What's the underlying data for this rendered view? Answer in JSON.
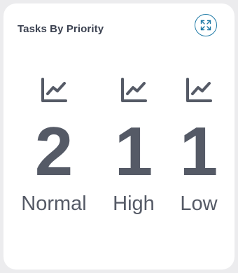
{
  "card": {
    "title": "Tasks By Priority",
    "expand_icon": "expand-arrows-icon"
  },
  "stats": [
    {
      "icon": "line-chart-icon",
      "value": "2",
      "label": "Normal"
    },
    {
      "icon": "line-chart-icon",
      "value": "1",
      "label": "High"
    },
    {
      "icon": "line-chart-icon",
      "value": "1",
      "label": "Low"
    }
  ],
  "colors": {
    "text": "#555a66",
    "title": "#3b4150",
    "accent": "#1f7aa6",
    "background": "#ececee",
    "card": "#ffffff"
  }
}
